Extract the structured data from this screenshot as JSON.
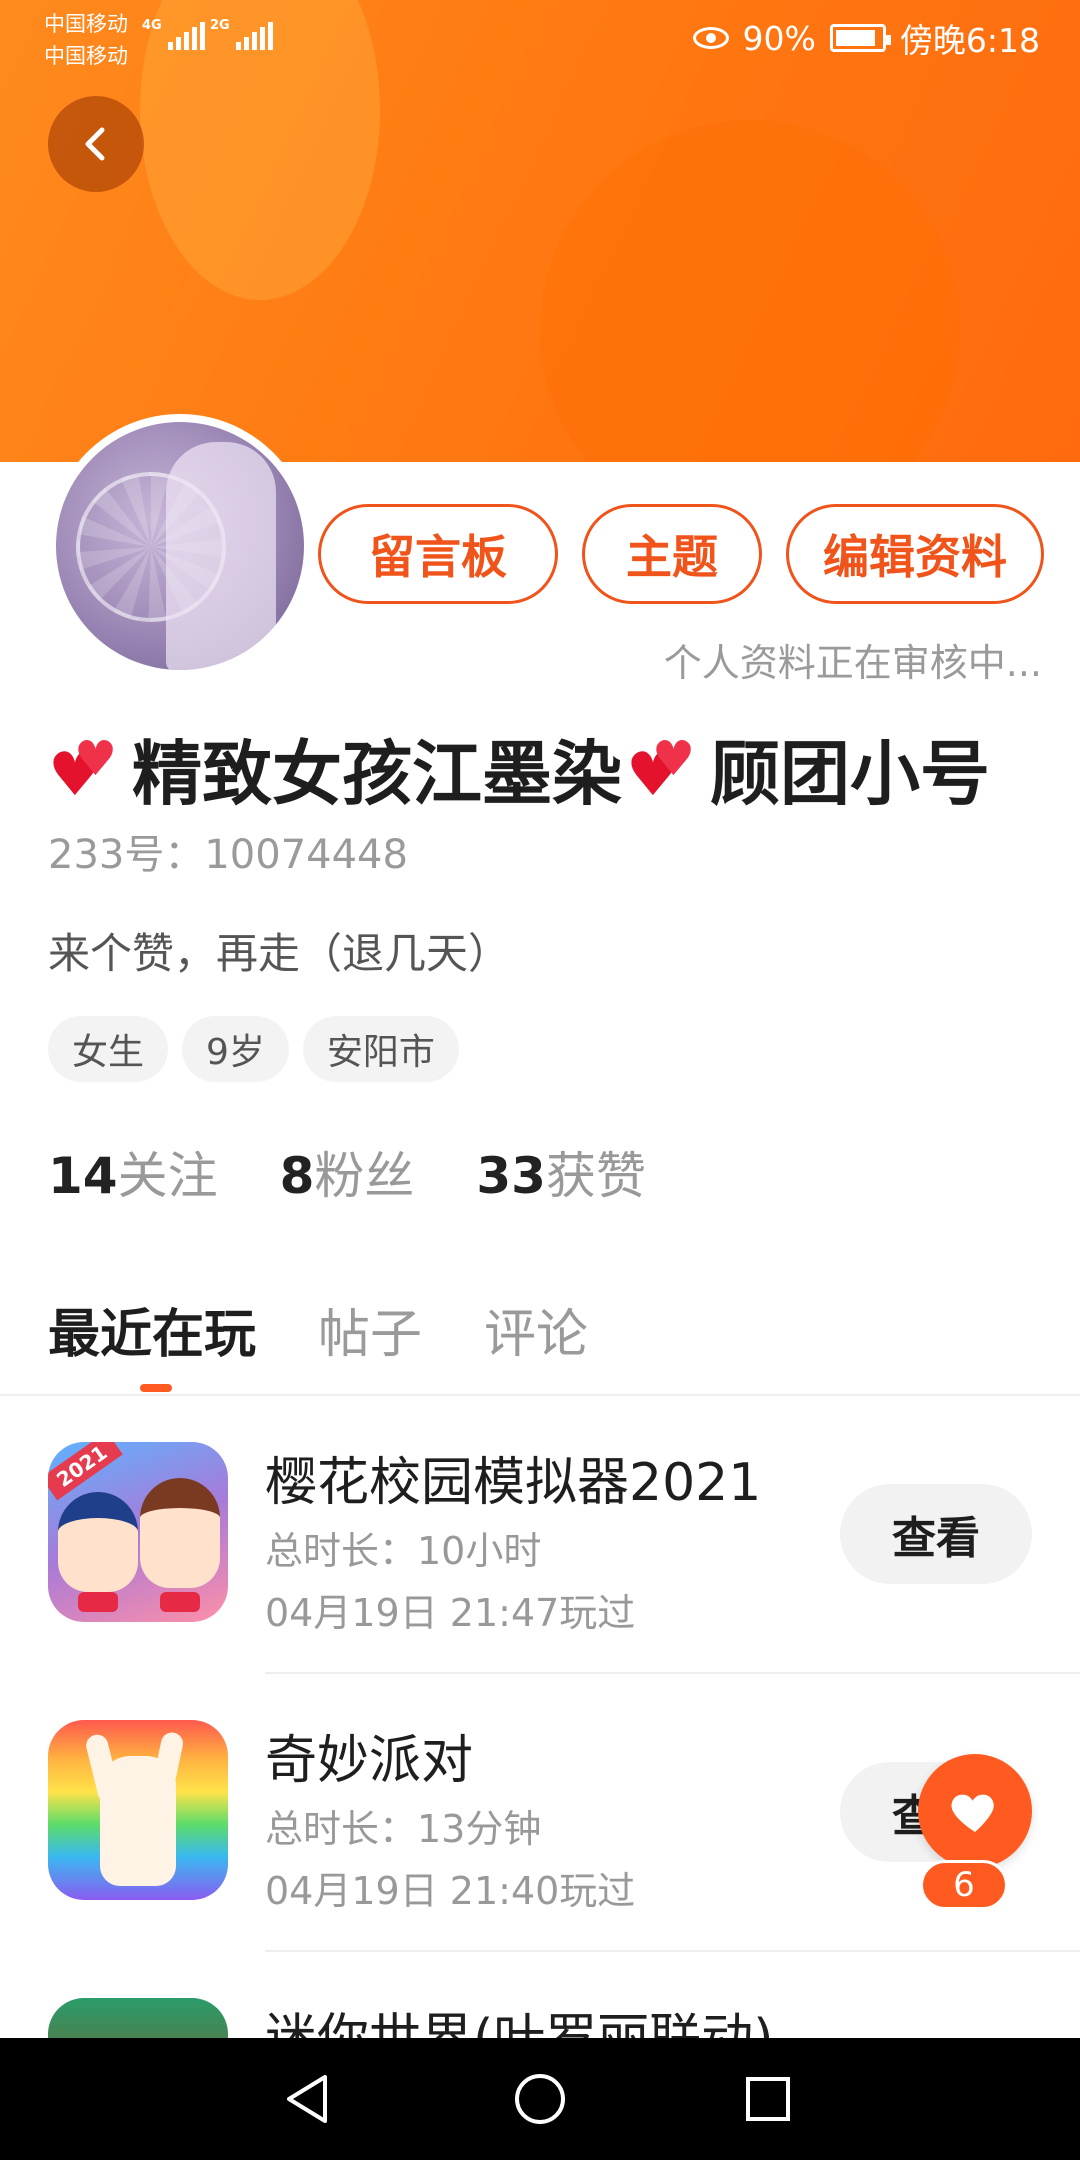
{
  "status_bar": {
    "carrier_1": "中国移动",
    "carrier_2": "中国移动",
    "network_1": "4G",
    "network_2": "2G",
    "battery": "90%",
    "time": "傍晚6:18"
  },
  "profile": {
    "actions": {
      "message_board": "留言板",
      "theme": "主题",
      "edit_profile": "编辑资料"
    },
    "review_note": "个人资料正在审核中...",
    "nickname_part1": "精致女孩江墨染",
    "nickname_part2": "顾团小号",
    "user_id": "233号：10074448",
    "bio": "来个赞，再走（退几天）",
    "tags": [
      "女生",
      "9岁",
      "安阳市"
    ],
    "stats": {
      "following": {
        "num": "14",
        "label": "关注"
      },
      "followers": {
        "num": "8",
        "label": "粉丝"
      },
      "likes": {
        "num": "33",
        "label": "获赞"
      }
    }
  },
  "tabs": [
    "最近在玩",
    "帖子",
    "评论"
  ],
  "games": [
    {
      "title": "樱花校园模拟器2021",
      "duration": "总时长：10小时",
      "last_played": "04月19日 21:47玩过",
      "action": "查看",
      "icon_badge": "2021"
    },
    {
      "title": "奇妙派对",
      "duration": "总时长：13分钟",
      "last_played": "04月19日 21:40玩过",
      "action": "查看"
    },
    {
      "title": "迷你世界(叶罗丽联动)"
    }
  ],
  "like_button": {
    "count": "6"
  },
  "colors": {
    "accent": "#ff5a1f",
    "banner": "#ff7a12"
  }
}
